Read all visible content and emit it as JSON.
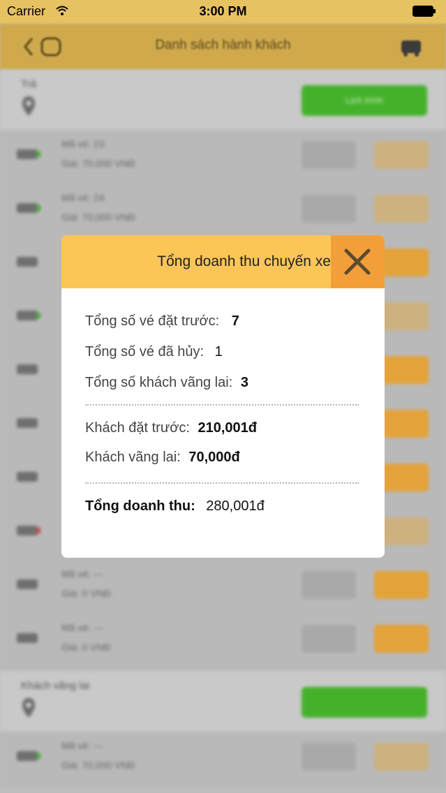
{
  "status_bar": {
    "carrier": "Carrier",
    "time": "3:00 PM"
  },
  "nav": {
    "title": "Danh sách hành khách"
  },
  "sections": [
    {
      "label": "Trả",
      "button": "Lịch trình"
    },
    {
      "label": "Khách vãng lai",
      "button": ""
    }
  ],
  "rows": [
    {
      "line1": "Mã vé: 23",
      "line2": "Giá: 70,000 VNĐ",
      "indicator": "green",
      "action_faded": true
    },
    {
      "line1": "Mã vé: 24",
      "line2": "Giá: 70,000 VNĐ",
      "indicator": "green",
      "action_faded": true
    },
    {
      "line1": "",
      "line2": "",
      "indicator": "none",
      "action_faded": false
    },
    {
      "line1": "",
      "line2": "",
      "indicator": "green",
      "action_faded": true
    },
    {
      "line1": "",
      "line2": "",
      "indicator": "none",
      "action_faded": false
    },
    {
      "line1": "",
      "line2": "",
      "indicator": "none",
      "action_faded": false
    },
    {
      "line1": "",
      "line2": "",
      "indicator": "none",
      "action_faded": false
    },
    {
      "line1": "",
      "line2": "",
      "indicator": "red",
      "action_faded": true
    },
    {
      "line1": "Mã vé: ---",
      "line2": "Giá: 0 VNĐ",
      "indicator": "none",
      "action_faded": false
    },
    {
      "line1": "Mã vé: ---",
      "line2": "Giá: 0 VNĐ",
      "indicator": "none",
      "action_faded": false
    },
    {
      "line1": "Mã vé: ---",
      "line2": "Giá: 70,000 VNĐ",
      "indicator": "green",
      "action_faded": true
    }
  ],
  "modal": {
    "title": "Tổng doanh thu chuyến xe",
    "prebooked_label": "Tổng số vé đặt trước:",
    "prebooked_value": "7",
    "cancelled_label": "Tổng số vé đã hủy:",
    "cancelled_value": "1",
    "walkin_label": "Tổng số khách vãng lai:",
    "walkin_value": "3",
    "prebooked_revenue_label": "Khách đặt trước:",
    "prebooked_revenue_value": "210,001đ",
    "walkin_revenue_label": "Khách vãng lai:",
    "walkin_revenue_value": "70,000đ",
    "total_label": "Tổng doanh thu:",
    "total_value": "280,001đ"
  },
  "colors": {
    "header_yellow": "#fcc558",
    "close_orange": "#f29f3a",
    "green_button": "#45b12b",
    "orange_button": "#e3a33a"
  },
  "icons": {
    "close": "close-icon",
    "back": "back-icon",
    "map_pin": "map-pin-icon",
    "wifi": "wifi-icon",
    "battery": "battery-icon"
  }
}
